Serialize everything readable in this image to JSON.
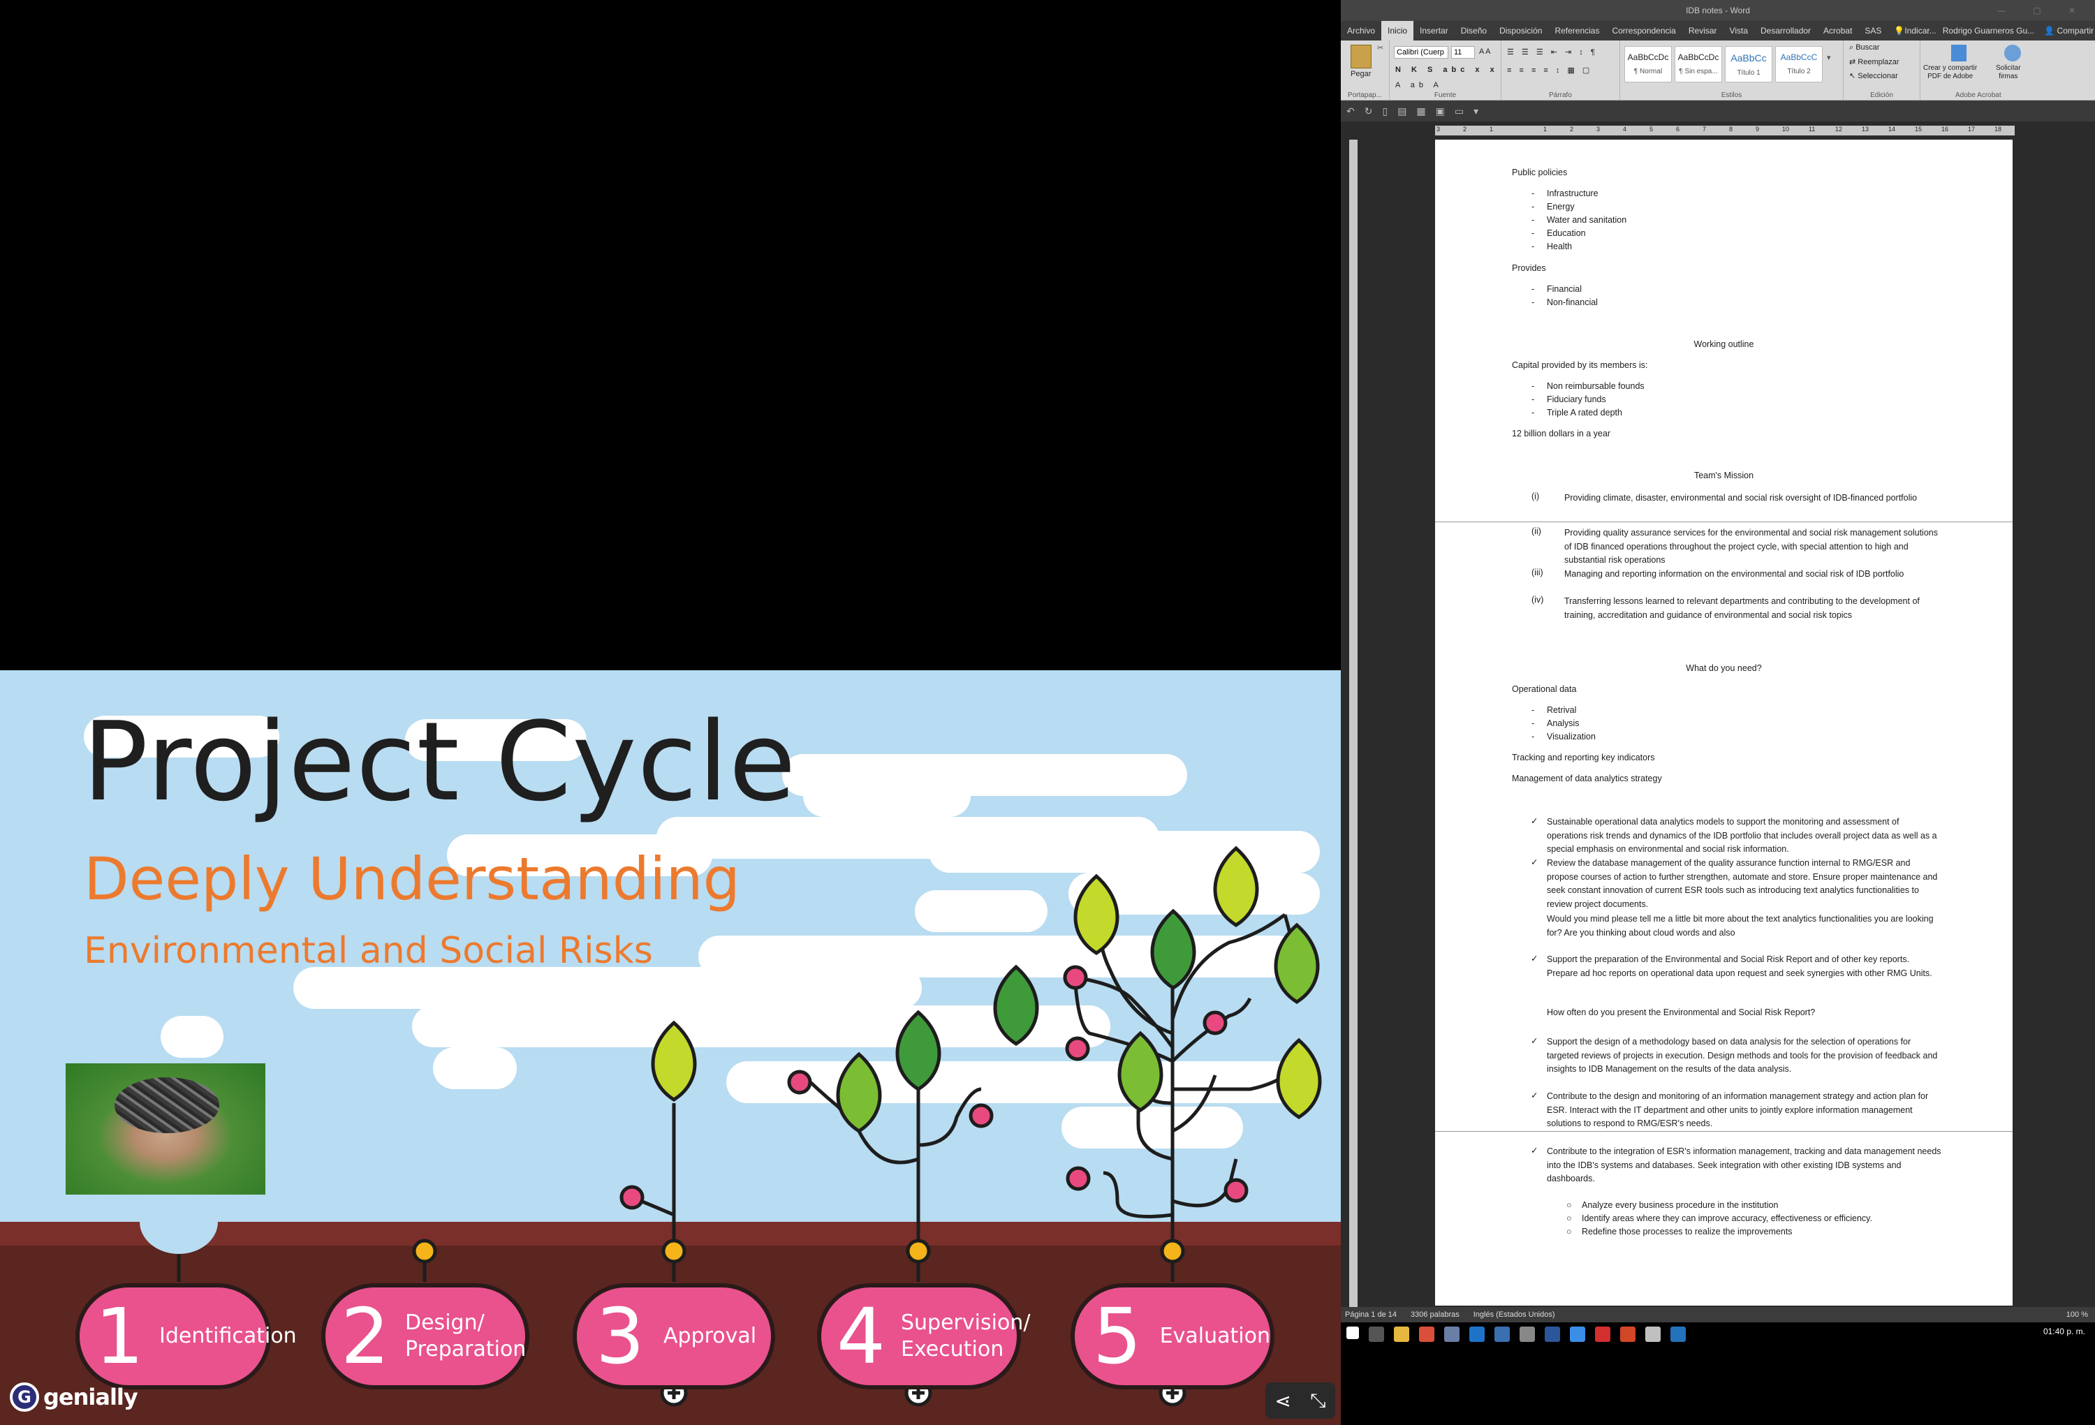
{
  "genially": {
    "title": "Project Cycle",
    "subtitle1": "Deeply Understanding",
    "subtitle2": "Environmental and Social Risks",
    "steps": [
      {
        "num": "1",
        "label": "Identification"
      },
      {
        "num": "2",
        "label": "Design/\nPreparation"
      },
      {
        "num": "3",
        "label": "Approval"
      },
      {
        "num": "4",
        "label": "Supervision/\nExecution"
      },
      {
        "num": "5",
        "label": "Evaluation"
      }
    ],
    "logo": "genially",
    "colors": {
      "sky": "#b8dcf1",
      "soil_top": "#7a2f2a",
      "soil": "#5b2520",
      "step": "#e9528d",
      "title": "#1f1f1f",
      "accent": "#ec7a2e",
      "leaf_dark": "#3f9a3a",
      "leaf_mid": "#7bbd33",
      "leaf_light": "#c3d92b",
      "dot_pink": "#e84a7f",
      "dot_yellow": "#f4b41a"
    },
    "icons": {
      "share": "share-icon",
      "collapse": "collapse-icon",
      "plus": "plus-circle-icon"
    }
  },
  "word": {
    "window_title": "IDB notes  -  Word",
    "tabs": [
      "Archivo",
      "Inicio",
      "Insertar",
      "Diseño",
      "Disposición",
      "Referencias",
      "Correspondencia",
      "Revisar",
      "Vista",
      "Desarrollador",
      "Acrobat",
      "SAS"
    ],
    "tell_me": "Indicar...",
    "user": "Rodrigo Guarneros Gu...",
    "share_label": "Compartir",
    "ribbon": {
      "clipboard": {
        "label": "Portapap...",
        "paste": "Pegar"
      },
      "font": {
        "label": "Fuente",
        "name": "Calibri (Cuerp",
        "size": "11"
      },
      "paragraph": {
        "label": "Párrafo"
      },
      "styles": {
        "label": "Estilos",
        "items": [
          {
            "preview": "AaBbCcDc",
            "name": "¶ Normal"
          },
          {
            "preview": "AaBbCcDc",
            "name": "¶ Sin espa..."
          },
          {
            "preview": "AaBbCc",
            "name": "Título 1"
          },
          {
            "preview": "AaBbCcC",
            "name": "Título 2"
          }
        ]
      },
      "editing": {
        "label": "Edición",
        "find": "Buscar",
        "replace": "Reemplazar",
        "select": "Seleccionar"
      },
      "acrobat": {
        "label": "Adobe Acrobat",
        "create": "Crear y compartir\nPDF de Adobe",
        "request": "Solicitar\nfirmas"
      }
    },
    "ruler": [
      "3",
      "2",
      "1",
      "1",
      "2",
      "3",
      "4",
      "5",
      "6",
      "7",
      "8",
      "9",
      "10",
      "11",
      "12",
      "13",
      "14",
      "15",
      "16",
      "17",
      "18"
    ],
    "doc": {
      "public_policies": "Public policies",
      "pp_items": [
        "Infrastructure",
        "Energy",
        "Water and sanitation",
        "Education",
        "Health"
      ],
      "provides": "Provides",
      "prov_items": [
        "Financial",
        "Non-financial"
      ],
      "working_outline": "Working outline",
      "capital": "Capital provided by its members is:",
      "cap_items": [
        "Non reimbursable founds",
        "Fiduciary funds",
        "Triple A rated depth"
      ],
      "billion": "12 billion dollars in a year",
      "team_mission": "Team's Mission",
      "mission": [
        {
          "n": "(i)",
          "t": "Providing climate, disaster, environmental and social risk oversight of IDB-financed portfolio"
        },
        {
          "n": "(ii)",
          "t": "Providing quality assurance services for the environmental and social risk management solutions of IDB financed operations throughout the project cycle, with special attention to high and substantial risk operations"
        },
        {
          "n": "(iii)",
          "t": "Managing and reporting information on the environmental and social risk of IDB portfolio"
        },
        {
          "n": "(iv)",
          "t": "Transferring lessons learned to relevant departments and contributing to the development of training, accreditation and guidance of environmental and social risk topics"
        }
      ],
      "what_need": "What do you need?",
      "operational_data": "Operational data",
      "od_items": [
        "Retrival",
        "Analysis",
        "Visualization"
      ],
      "tracking": "Tracking and reporting key indicators",
      "management": "Management of data analytics strategy",
      "check1": "Sustainable operational data analytics models to support the monitoring and assessment of operations risk trends and dynamics of the IDB portfolio that includes overall project data as well as a special emphasis on environmental and social risk information.",
      "check2": "Review the database management of the quality assurance function internal to RMG/ESR and propose courses of action to further strengthen, automate and store. Ensure proper maintenance and seek constant innovation of current ESR tools such as introducing text analytics functionalities to review project documents.",
      "q1": "Would you mind please tell me a little bit more about the text analytics functionalities you are looking for? Are you thinking about cloud words and also",
      "check3": "Support the preparation of the Environmental and Social Risk Report and of other key reports. Prepare ad hoc reports on operational data upon request and seek synergies with other RMG Units.",
      "q2": "How often do you present the Environmental and Social Risk Report?",
      "check4": "Support the design of a methodology based on data analysis for the selection of operations for targeted reviews of projects in execution. Design methods and tools for the provision of feedback and insights to IDB Management on the results of the data analysis.",
      "check5": "Contribute to the design and monitoring of an information management strategy and action plan for ESR. Interact with the IT department and other units to jointly explore information management solutions to respond to RMG/ESR's needs.",
      "check6": "Contribute to the integration of ESR's information management, tracking and data management needs into the IDB's systems and databases. Seek integration with other existing IDB systems and dashboards.",
      "sub_items": [
        "Analyze every business procedure in the institution",
        "Identify areas where they can improve accuracy, effectiveness or efficiency.",
        "Redefine those processes to realize the improvements"
      ]
    },
    "status": {
      "page": "Página 1 de 14",
      "words": "3306 palabras",
      "lang": "Inglés (Estados Unidos)",
      "zoom": "100 %"
    },
    "clock": "01:40 p. m."
  }
}
